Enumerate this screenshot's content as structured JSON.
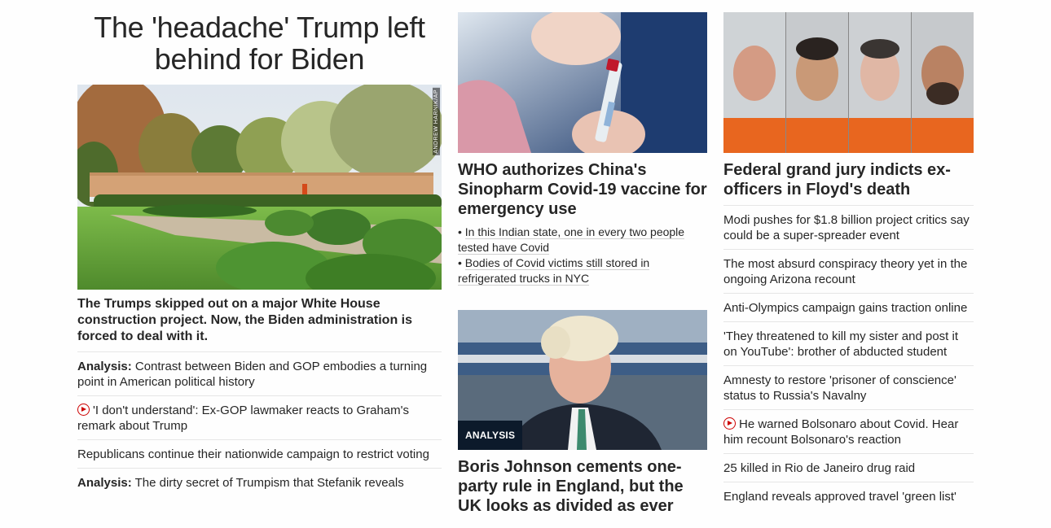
{
  "col1": {
    "headline": "The 'headache' Trump left behind for Biden",
    "image_credit": "ANDREW HARNIK/AP",
    "lead_sub": "The Trumps skipped out on a major White House construction project. Now, the Biden administration is forced to deal with it.",
    "items": [
      {
        "prefix": "Analysis:",
        "text": " Contrast between Biden and GOP embodies a turning point in American political history",
        "video": false
      },
      {
        "prefix": "",
        "text": "'I don't understand': Ex-GOP lawmaker reacts to Graham's remark about Trump",
        "video": true
      },
      {
        "prefix": "",
        "text": "Republicans continue their nationwide campaign to restrict voting",
        "video": false
      },
      {
        "prefix": "Analysis:",
        "text": " The dirty secret of Trumpism that Stefanik reveals",
        "video": false
      }
    ]
  },
  "col2": {
    "story1": {
      "headline": "WHO authorizes China's Sinopharm Covid-19 vaccine for emergency use",
      "bullets": [
        "In this Indian state, one in every two people tested have Covid",
        "Bodies of Covid victims still stored in refrigerated trucks in NYC"
      ]
    },
    "story2": {
      "tag": "ANALYSIS",
      "headline": "Boris Johnson cements one-party rule in England, but the UK looks as divided as ever"
    }
  },
  "col3": {
    "headline": "Federal grand jury indicts ex-officers in Floyd's death",
    "items": [
      {
        "text": "Modi pushes for $1.8 billion project critics say could be a super-spreader event",
        "video": false
      },
      {
        "text": "The most absurd conspiracy theory yet in the ongoing Arizona recount",
        "video": false
      },
      {
        "text": "Anti-Olympics campaign gains traction online",
        "video": false
      },
      {
        "text": "'They threatened to kill my sister and post it on YouTube': brother of abducted student",
        "video": false
      },
      {
        "text": "Amnesty to restore 'prisoner of conscience' status to Russia's Navalny",
        "video": false
      },
      {
        "text": "He warned Bolsonaro about Covid. Hear him recount Bolsonaro's reaction",
        "video": true
      },
      {
        "text": "25 killed in Rio de Janeiro drug raid",
        "video": false
      },
      {
        "text": "England reveals approved travel 'green list'",
        "video": false
      }
    ]
  },
  "colors": {
    "text": "#262626",
    "video_red": "#cc0000",
    "divider": "#e6e6e6",
    "tag_bg": "#0c1a2b"
  }
}
